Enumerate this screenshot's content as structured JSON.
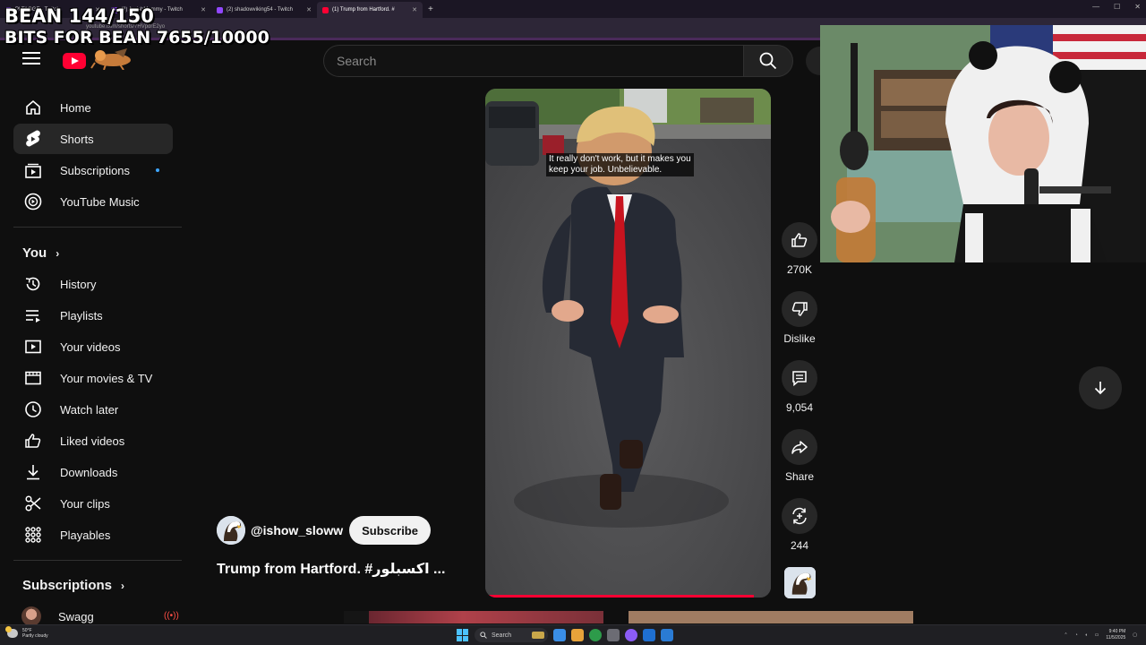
{
  "browser": {
    "tabs": [
      {
        "label": "PLTAGGE - Twitch",
        "active": false
      },
      {
        "label": "(2) AmishMommy - Twitch",
        "active": false
      },
      {
        "label": "(2) shadowviking54 - Twitch",
        "active": false
      },
      {
        "label": "(1) Trump from Hartford. #",
        "active": true
      }
    ],
    "new_tab": "+",
    "url": "youtube.com/shorts/7HVpdrE2yo"
  },
  "overlay": {
    "line1": "BEAN 144/150",
    "line2": "BITS FOR BEAN 7655/10000"
  },
  "header": {
    "search_placeholder": "Search"
  },
  "sidebar": {
    "main": [
      {
        "label": "Home",
        "icon": "home-icon"
      },
      {
        "label": "Shorts",
        "icon": "shorts-icon",
        "active": true
      },
      {
        "label": "Subscriptions",
        "icon": "subscriptions-icon",
        "badge": true
      },
      {
        "label": "YouTube Music",
        "icon": "youtube-music-icon"
      }
    ],
    "you_heading": "You",
    "you": [
      {
        "label": "History",
        "icon": "history-icon"
      },
      {
        "label": "Playlists",
        "icon": "playlists-icon"
      },
      {
        "label": "Your videos",
        "icon": "your-videos-icon"
      },
      {
        "label": "Your movies & TV",
        "icon": "movies-icon"
      },
      {
        "label": "Watch later",
        "icon": "clock-icon"
      },
      {
        "label": "Liked videos",
        "icon": "thumbs-up-icon"
      },
      {
        "label": "Downloads",
        "icon": "download-icon"
      },
      {
        "label": "Your clips",
        "icon": "scissors-icon"
      },
      {
        "label": "Playables",
        "icon": "playables-icon"
      }
    ],
    "subs_heading": "Subscriptions",
    "subs": [
      {
        "label": "Swagg",
        "live": true
      }
    ]
  },
  "short": {
    "caption": "It really don't work, but it makes you\nkeep your job. Unbelievable.",
    "channel": "@ishow_sloww",
    "subscribe_label": "Subscribe",
    "title": "Trump from Hartford. #اكسبلور ...",
    "progress": 0.94
  },
  "actions": {
    "likes": "270K",
    "dislike_label": "Dislike",
    "comments": "9,054",
    "share_label": "Share",
    "remixes": "244"
  },
  "taskbar": {
    "weather_temp": "50°F",
    "weather_desc": "Partly cloudy",
    "search_label": "Search",
    "time": "9:40 PM",
    "date": "11/5/2025"
  },
  "colors": {
    "accent": "#ff0033",
    "background": "#0f0f0f",
    "chip": "#272727",
    "link": "#3ea6ff"
  }
}
